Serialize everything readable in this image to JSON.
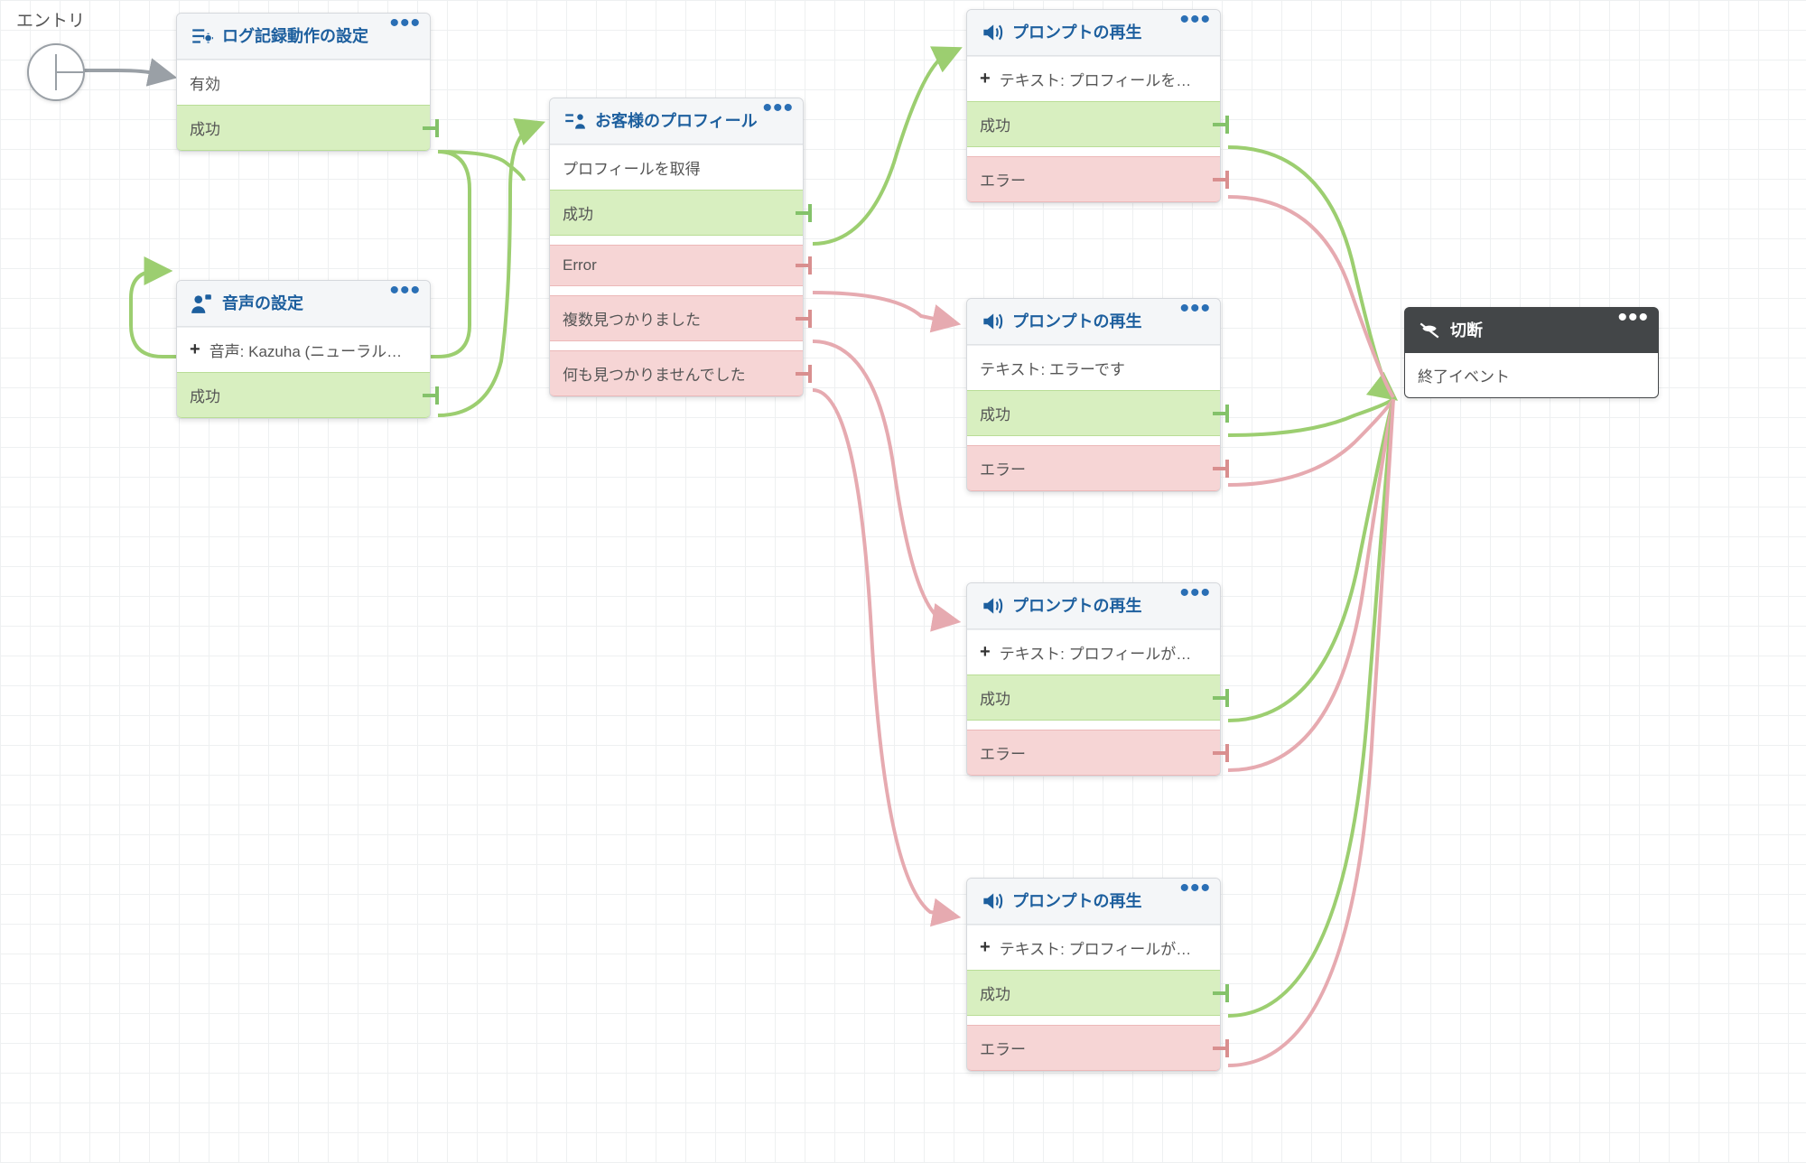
{
  "entry": {
    "label": "エントリ"
  },
  "blocks": {
    "logging": {
      "title": "ログ記録動作の設定",
      "param": "有効",
      "outcomes": [
        "成功"
      ]
    },
    "voice": {
      "title": "音声の設定",
      "param": "音声: Kazuha (ニューラル…",
      "outcomes": [
        "成功"
      ]
    },
    "profile": {
      "title": "お客様のプロフィール",
      "param": "プロフィールを取得",
      "outcomes": [
        "成功",
        "Error",
        "複数見つかりました",
        "何も見つかりませんでした"
      ]
    },
    "prompt1": {
      "title": "プロンプトの再生",
      "param": "テキスト: プロフィールを…",
      "outcomes": [
        "成功",
        "エラー"
      ]
    },
    "prompt2": {
      "title": "プロンプトの再生",
      "param": "テキスト: エラーです",
      "outcomes": [
        "成功",
        "エラー"
      ]
    },
    "prompt3": {
      "title": "プロンプトの再生",
      "param": "テキスト: プロフィールが…",
      "outcomes": [
        "成功",
        "エラー"
      ]
    },
    "prompt4": {
      "title": "プロンプトの再生",
      "param": "テキスト: プロフィールが…",
      "outcomes": [
        "成功",
        "エラー"
      ]
    },
    "disconnect": {
      "title": "切断",
      "param": "終了イベント"
    }
  },
  "connections": [
    {
      "from": "entry",
      "to": "logging",
      "kind": "neutral"
    },
    {
      "from": "logging.成功",
      "to": "voice",
      "kind": "success"
    },
    {
      "from": "logging.成功",
      "to": "profile",
      "kind": "success"
    },
    {
      "from": "voice.成功",
      "to": "profile",
      "kind": "success"
    },
    {
      "from": "profile.成功",
      "to": "prompt1",
      "kind": "success"
    },
    {
      "from": "profile.Error",
      "to": "prompt2",
      "kind": "error"
    },
    {
      "from": "profile.複数見つかりました",
      "to": "prompt3",
      "kind": "error"
    },
    {
      "from": "profile.何も見つかりませんでした",
      "to": "prompt4",
      "kind": "error"
    },
    {
      "from": "prompt1.成功",
      "to": "disconnect",
      "kind": "success"
    },
    {
      "from": "prompt1.エラー",
      "to": "disconnect",
      "kind": "error"
    },
    {
      "from": "prompt2.成功",
      "to": "disconnect",
      "kind": "success"
    },
    {
      "from": "prompt2.エラー",
      "to": "disconnect",
      "kind": "error"
    },
    {
      "from": "prompt3.成功",
      "to": "disconnect",
      "kind": "success"
    },
    {
      "from": "prompt3.エラー",
      "to": "disconnect",
      "kind": "error"
    },
    {
      "from": "prompt4.成功",
      "to": "disconnect",
      "kind": "success"
    },
    {
      "from": "prompt4.エラー",
      "to": "disconnect",
      "kind": "error"
    }
  ],
  "colors": {
    "success": "#9cce70",
    "error": "#e6aab0",
    "neutral": "#9aa0a6",
    "title": "#1d5f9e"
  }
}
